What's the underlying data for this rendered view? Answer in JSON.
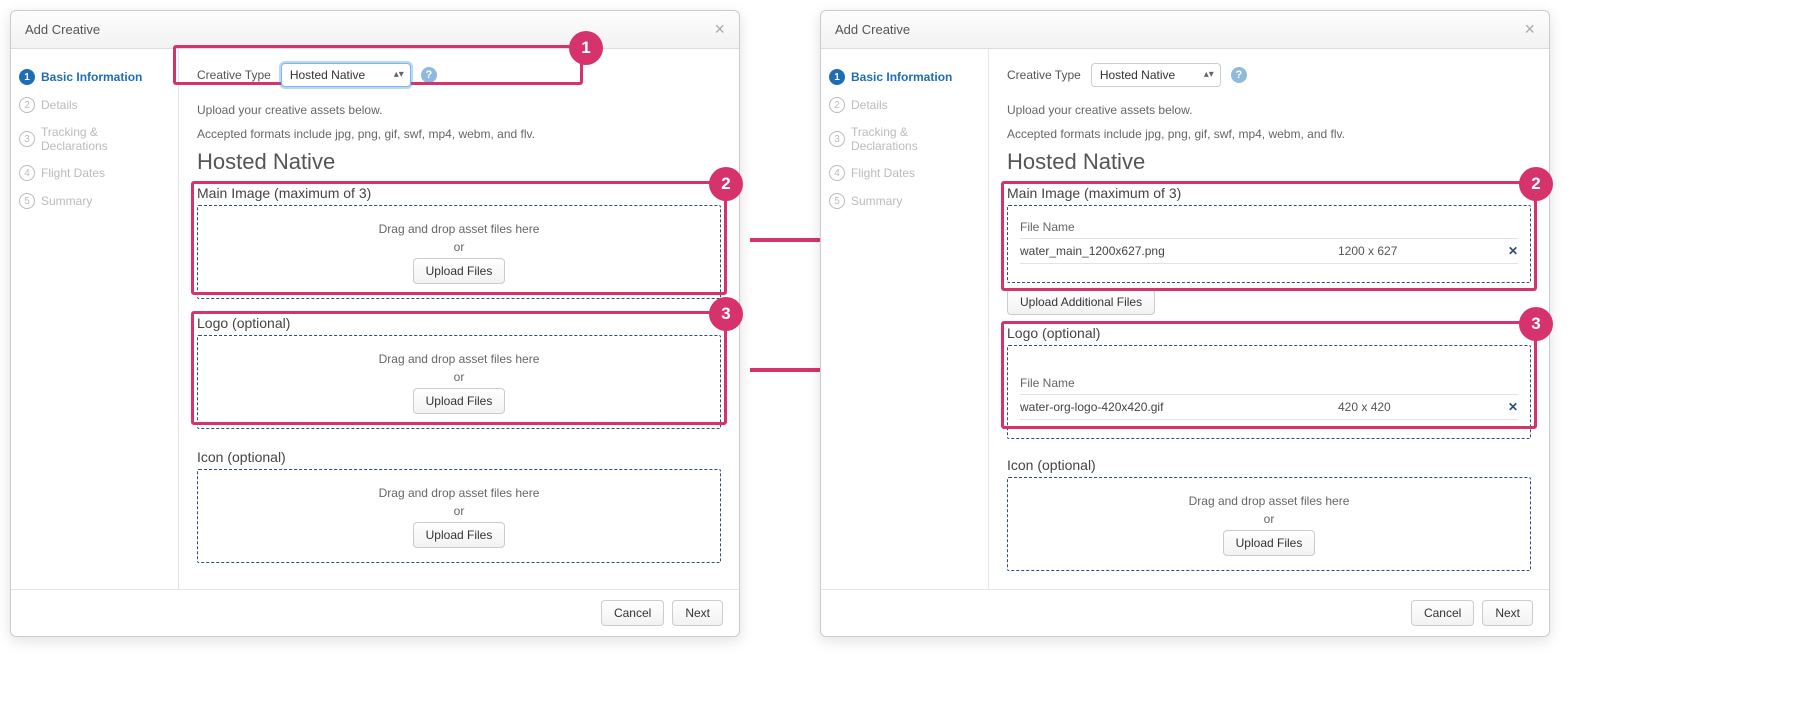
{
  "modal_title": "Add Creative",
  "steps": [
    {
      "num": "1",
      "label": "Basic Information",
      "active": true
    },
    {
      "num": "2",
      "label": "Details",
      "active": false
    },
    {
      "num": "3",
      "label": "Tracking & Declarations",
      "active": false
    },
    {
      "num": "4",
      "label": "Flight Dates",
      "active": false
    },
    {
      "num": "5",
      "label": "Summary",
      "active": false
    }
  ],
  "creative_type_label": "Creative Type",
  "creative_type_value": "Hosted Native",
  "upload_hint1": "Upload your creative assets below.",
  "upload_hint2": "Accepted formats include jpg, png, gif, swf, mp4, webm, and flv.",
  "section_title": "Hosted Native",
  "main_image_label": "Main Image (maximum of 3)",
  "logo_label": "Logo (optional)",
  "icon_label": "Icon (optional)",
  "drag_text": "Drag and drop asset files here",
  "or_text": "or",
  "upload_files_btn": "Upload Files",
  "upload_additional_btn": "Upload Additional Files",
  "file_name_header": "File Name",
  "cancel_btn": "Cancel",
  "next_btn": "Next",
  "callouts": {
    "one": "1",
    "two": "2",
    "three": "3"
  },
  "right_panel": {
    "main_image_file": {
      "name": "water_main_1200x627.png",
      "dim": "1200 x 627"
    },
    "logo_file": {
      "name": "water-org-logo-420x420.gif",
      "dim": "420 x 420"
    }
  }
}
